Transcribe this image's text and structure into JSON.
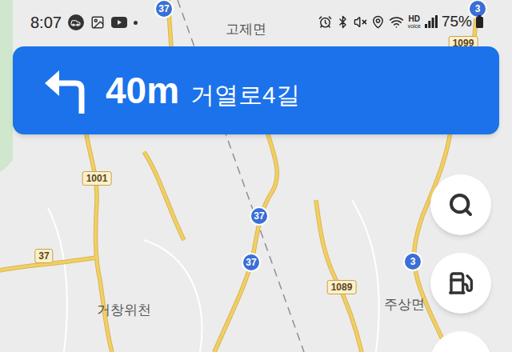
{
  "status_bar": {
    "time": "8:07",
    "hd": "HD",
    "hd_sub": "voice",
    "battery": "75%"
  },
  "navigation": {
    "maneuver": "turn-left",
    "distance": "40m",
    "street": "거열로4길"
  },
  "map": {
    "labels": [
      {
        "text": "고제면"
      },
      {
        "text": "거창위천"
      },
      {
        "text": "주상면"
      }
    ],
    "shields": [
      {
        "text": "37",
        "kind": "national"
      },
      {
        "text": "3",
        "kind": "national"
      },
      {
        "text": "1099",
        "kind": "local"
      },
      {
        "text": "1001",
        "kind": "local"
      },
      {
        "text": "37",
        "kind": "local"
      },
      {
        "text": "37",
        "kind": "national"
      },
      {
        "text": "37",
        "kind": "national"
      },
      {
        "text": "3",
        "kind": "national"
      },
      {
        "text": "1089",
        "kind": "local"
      }
    ]
  }
}
